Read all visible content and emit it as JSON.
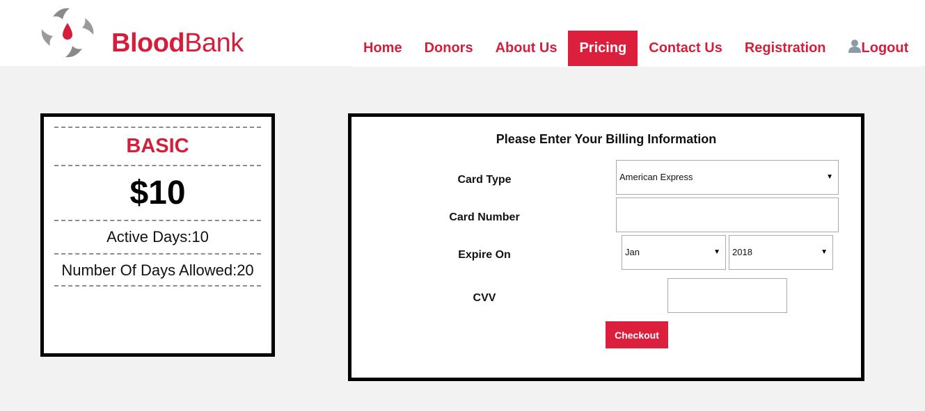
{
  "brand": {
    "name_bold": "Blood",
    "name_rest": "Bank",
    "accent_color": "#dc1f3c"
  },
  "nav": {
    "items": [
      {
        "label": "Home",
        "active": false
      },
      {
        "label": "Donors",
        "active": false
      },
      {
        "label": "About Us",
        "active": false
      },
      {
        "label": "Pricing",
        "active": true
      },
      {
        "label": "Contact Us",
        "active": false
      },
      {
        "label": "Registration",
        "active": false
      },
      {
        "label": "Logout",
        "active": false,
        "icon": "user-icon"
      }
    ]
  },
  "plan": {
    "name": "BASIC",
    "price": "$10",
    "active_days": "Active Days:10",
    "days_allowed": "Number Of Days Allowed:20"
  },
  "billing": {
    "title": "Please Enter Your Billing Information",
    "card_type_label": "Card Type",
    "card_type_value": "American Express",
    "card_number_label": "Card Number",
    "card_number_value": "",
    "expire_label": "Expire On",
    "expire_month": "Jan",
    "expire_year": "2018",
    "cvv_label": "CVV",
    "cvv_value": "",
    "checkout_label": "Checkout"
  }
}
